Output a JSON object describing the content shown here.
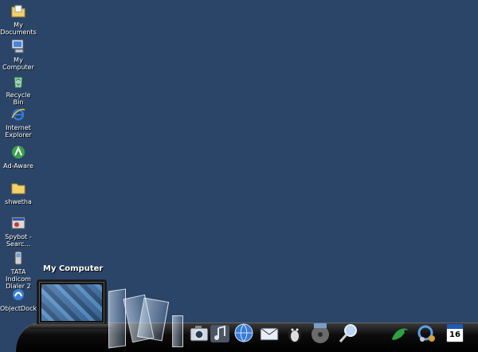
{
  "desktop": {
    "icons": [
      {
        "label": "My Documents"
      },
      {
        "label": "My Computer"
      },
      {
        "label": "Recycle Bin"
      },
      {
        "label": "Internet Explorer"
      },
      {
        "label": "Ad-Aware"
      },
      {
        "label": "shwetha"
      },
      {
        "label": "Spybot - Searc..."
      },
      {
        "label": "TATA Indicom Dialer 2"
      },
      {
        "label": "ObjectDock"
      }
    ]
  },
  "dock": {
    "hover_label": "My Computer",
    "calendar_day": "16",
    "items": [
      "my-computer",
      "glass-panels",
      "camera",
      "music",
      "globe",
      "mail",
      "penguin",
      "disc",
      "search",
      "gecko",
      "tools",
      "calendar"
    ]
  },
  "colors": {
    "desktop_background": "#2b4569",
    "dock_shelf": "#0d0d0d",
    "label_text": "#ffffff"
  }
}
